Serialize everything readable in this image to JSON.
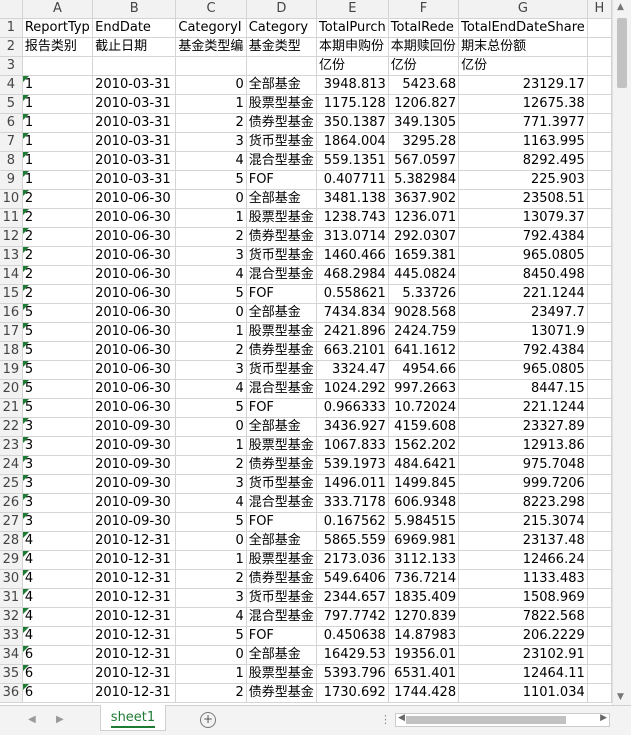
{
  "columns": [
    "A",
    "B",
    "C",
    "D",
    "E",
    "F",
    "G",
    "H"
  ],
  "rows": [
    {
      "n": "1",
      "cells": [
        "ReportTyp",
        "EndDate",
        "CategoryI",
        "Category",
        "TotalPurch",
        "TotalRede",
        "TotalEndDateShare",
        ""
      ]
    },
    {
      "n": "2",
      "cells": [
        "报告类别",
        "截止日期",
        "基金类型编",
        "基金类型",
        "本期申购份",
        "本期赎回份",
        "期末总份额",
        ""
      ]
    },
    {
      "n": "3",
      "cells": [
        "",
        "",
        "",
        "",
        "亿份",
        "亿份",
        "亿份",
        ""
      ]
    },
    {
      "n": "4",
      "cells": [
        "1",
        "2010-03-31",
        "0",
        "全部基金",
        "3948.813",
        "5423.68",
        "23129.17",
        ""
      ]
    },
    {
      "n": "5",
      "cells": [
        "1",
        "2010-03-31",
        "1",
        "股票型基金",
        "1175.128",
        "1206.827",
        "12675.38",
        ""
      ]
    },
    {
      "n": "6",
      "cells": [
        "1",
        "2010-03-31",
        "2",
        "债券型基金",
        "350.1387",
        "349.1305",
        "771.3977",
        ""
      ]
    },
    {
      "n": "7",
      "cells": [
        "1",
        "2010-03-31",
        "3",
        "货币型基金",
        "1864.004",
        "3295.28",
        "1163.995",
        ""
      ]
    },
    {
      "n": "8",
      "cells": [
        "1",
        "2010-03-31",
        "4",
        "混合型基金",
        "559.1351",
        "567.0597",
        "8292.495",
        ""
      ]
    },
    {
      "n": "9",
      "cells": [
        "1",
        "2010-03-31",
        "5",
        "FOF",
        "0.407711",
        "5.382984",
        "225.903",
        ""
      ]
    },
    {
      "n": "10",
      "cells": [
        "2",
        "2010-06-30",
        "0",
        "全部基金",
        "3481.138",
        "3637.902",
        "23508.51",
        ""
      ]
    },
    {
      "n": "11",
      "cells": [
        "2",
        "2010-06-30",
        "1",
        "股票型基金",
        "1238.743",
        "1236.071",
        "13079.37",
        ""
      ]
    },
    {
      "n": "12",
      "cells": [
        "2",
        "2010-06-30",
        "2",
        "债券型基金",
        "313.0714",
        "292.0307",
        "792.4384",
        ""
      ]
    },
    {
      "n": "13",
      "cells": [
        "2",
        "2010-06-30",
        "3",
        "货币型基金",
        "1460.466",
        "1659.381",
        "965.0805",
        ""
      ]
    },
    {
      "n": "14",
      "cells": [
        "2",
        "2010-06-30",
        "4",
        "混合型基金",
        "468.2984",
        "445.0824",
        "8450.498",
        ""
      ]
    },
    {
      "n": "15",
      "cells": [
        "2",
        "2010-06-30",
        "5",
        "FOF",
        "0.558621",
        "5.33726",
        "221.1244",
        ""
      ]
    },
    {
      "n": "16",
      "cells": [
        "5",
        "2010-06-30",
        "0",
        "全部基金",
        "7434.834",
        "9028.568",
        "23497.7",
        ""
      ]
    },
    {
      "n": "17",
      "cells": [
        "5",
        "2010-06-30",
        "1",
        "股票型基金",
        "2421.896",
        "2424.759",
        "13071.9",
        ""
      ]
    },
    {
      "n": "18",
      "cells": [
        "5",
        "2010-06-30",
        "2",
        "债券型基金",
        "663.2101",
        "641.1612",
        "792.4384",
        ""
      ]
    },
    {
      "n": "19",
      "cells": [
        "5",
        "2010-06-30",
        "3",
        "货币型基金",
        "3324.47",
        "4954.66",
        "965.0805",
        ""
      ]
    },
    {
      "n": "20",
      "cells": [
        "5",
        "2010-06-30",
        "4",
        "混合型基金",
        "1024.292",
        "997.2663",
        "8447.15",
        ""
      ]
    },
    {
      "n": "21",
      "cells": [
        "5",
        "2010-06-30",
        "5",
        "FOF",
        "0.966333",
        "10.72024",
        "221.1244",
        ""
      ]
    },
    {
      "n": "22",
      "cells": [
        "3",
        "2010-09-30",
        "0",
        "全部基金",
        "3436.927",
        "4159.608",
        "23327.89",
        ""
      ]
    },
    {
      "n": "23",
      "cells": [
        "3",
        "2010-09-30",
        "1",
        "股票型基金",
        "1067.833",
        "1562.202",
        "12913.86",
        ""
      ]
    },
    {
      "n": "24",
      "cells": [
        "3",
        "2010-09-30",
        "2",
        "债券型基金",
        "539.1973",
        "484.6421",
        "975.7048",
        ""
      ]
    },
    {
      "n": "25",
      "cells": [
        "3",
        "2010-09-30",
        "3",
        "货币型基金",
        "1496.011",
        "1499.845",
        "999.7206",
        ""
      ]
    },
    {
      "n": "26",
      "cells": [
        "3",
        "2010-09-30",
        "4",
        "混合型基金",
        "333.7178",
        "606.9348",
        "8223.298",
        ""
      ]
    },
    {
      "n": "27",
      "cells": [
        "3",
        "2010-09-30",
        "5",
        "FOF",
        "0.167562",
        "5.984515",
        "215.3074",
        ""
      ]
    },
    {
      "n": "28",
      "cells": [
        "4",
        "2010-12-31",
        "0",
        "全部基金",
        "5865.559",
        "6969.981",
        "23137.48",
        ""
      ]
    },
    {
      "n": "29",
      "cells": [
        "4",
        "2010-12-31",
        "1",
        "股票型基金",
        "2173.036",
        "3112.133",
        "12466.24",
        ""
      ]
    },
    {
      "n": "30",
      "cells": [
        "4",
        "2010-12-31",
        "2",
        "债券型基金",
        "549.6406",
        "736.7214",
        "1133.483",
        ""
      ]
    },
    {
      "n": "31",
      "cells": [
        "4",
        "2010-12-31",
        "3",
        "货币型基金",
        "2344.657",
        "1835.409",
        "1508.969",
        ""
      ]
    },
    {
      "n": "32",
      "cells": [
        "4",
        "2010-12-31",
        "4",
        "混合型基金",
        "797.7742",
        "1270.839",
        "7822.568",
        ""
      ]
    },
    {
      "n": "33",
      "cells": [
        "4",
        "2010-12-31",
        "5",
        "FOF",
        "0.450638",
        "14.87983",
        "206.2229",
        ""
      ]
    },
    {
      "n": "34",
      "cells": [
        "6",
        "2010-12-31",
        "0",
        "全部基金",
        "16429.53",
        "19356.01",
        "23102.91",
        ""
      ]
    },
    {
      "n": "35",
      "cells": [
        "6",
        "2010-12-31",
        "1",
        "股票型基金",
        "5393.796",
        "6531.401",
        "12464.11",
        ""
      ]
    },
    {
      "n": "36",
      "cells": [
        "6",
        "2010-12-31",
        "2",
        "债券型基金",
        "1730.692",
        "1744.428",
        "1101.034",
        ""
      ]
    }
  ],
  "sheet_tab": "sheet1",
  "add_sheet_symbol": "+",
  "overflow_dots": "⋮",
  "accent_color": "#1e7b34"
}
